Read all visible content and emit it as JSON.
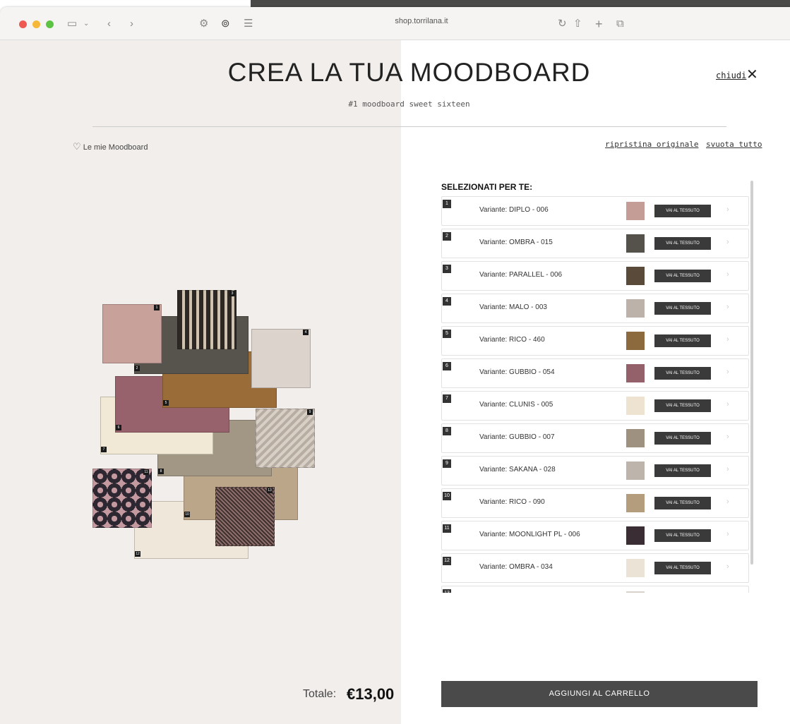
{
  "browser": {
    "url": "shop.torrilana.it",
    "icons": [
      "sidebar-icon",
      "back-icon",
      "forward-icon",
      "settings-icon",
      "pinterest-icon",
      "reader-icon",
      "reload-icon",
      "share-icon",
      "new-tab-icon",
      "tabs-icon"
    ]
  },
  "header": {
    "title": "CREA LA TUA MOODBOARD",
    "subtitle": "#1 moodboard sweet sixteen",
    "close_label": "chiudi",
    "close_icon": "close-icon"
  },
  "toolbar": {
    "my_moodboards": "Le mie Moodboard",
    "restore_label": "ripristina originale",
    "clear_label": "svuota tutto"
  },
  "selection": {
    "title": "SELEZIONATI PER TE:",
    "button_label": "VAI AL TESSUTO",
    "items": [
      {
        "num": "1",
        "label": "Variante: DIPLO - 006",
        "color": "#c49d96"
      },
      {
        "num": "2",
        "label": "Variante: OMBRA - 015",
        "color": "#55524c"
      },
      {
        "num": "3",
        "label": "Variante: PARALLEL - 006",
        "color": "#5a4a3a"
      },
      {
        "num": "4",
        "label": "Variante: MALO - 003",
        "color": "#bcb2aa"
      },
      {
        "num": "5",
        "label": "Variante: RICO - 460",
        "color": "#8d6a3d"
      },
      {
        "num": "6",
        "label": "Variante: GUBBIO - 054",
        "color": "#94606a"
      },
      {
        "num": "7",
        "label": "Variante: CLUNIS - 005",
        "color": "#ede3d0"
      },
      {
        "num": "8",
        "label": "Variante: GUBBIO - 007",
        "color": "#9e9180"
      },
      {
        "num": "9",
        "label": "Variante: SAKANA - 028",
        "color": "#bdb5ab"
      },
      {
        "num": "10",
        "label": "Variante: RICO - 090",
        "color": "#b39d7c"
      },
      {
        "num": "11",
        "label": "Variante: MOONLIGHT PL - 006",
        "color": "#3a2e34"
      },
      {
        "num": "12",
        "label": "Variante: OMBRA - 034",
        "color": "#ebe4d6"
      },
      {
        "num": "13",
        "label": "",
        "color": "#d8d2ca"
      }
    ]
  },
  "board_numbers": [
    "1",
    "2",
    "3",
    "4",
    "5",
    "6",
    "7",
    "8",
    "9",
    "10",
    "11",
    "12",
    "13"
  ],
  "footer": {
    "total_label": "Totale:",
    "total_value": "€13,00",
    "cart_label": "AGGIUNGI AL CARRELLO"
  }
}
